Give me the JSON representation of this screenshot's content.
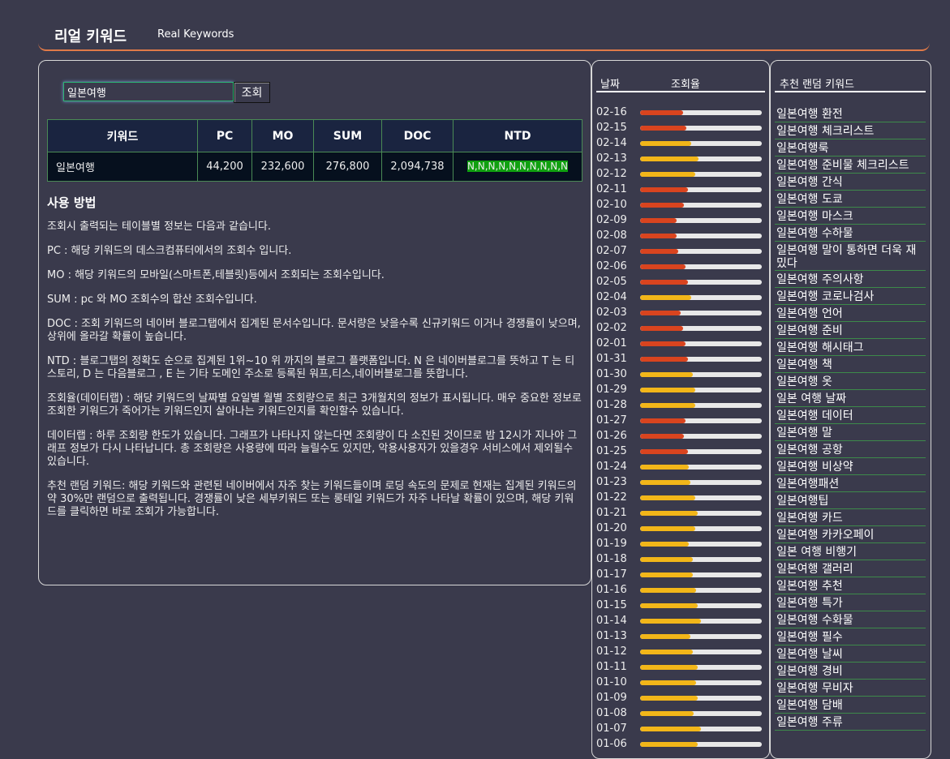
{
  "header": {
    "title": "리얼 키워드",
    "subtitle": "Real Keywords"
  },
  "search": {
    "value": "일본여행",
    "button_label": "조회"
  },
  "table": {
    "headers": [
      "키워드",
      "PC",
      "MO",
      "SUM",
      "DOC",
      "NTD"
    ],
    "row": {
      "keyword": "일본여행",
      "pc": "44,200",
      "mo": "232,600",
      "sum": "276,800",
      "doc": "2,094,738",
      "ntd": "N,N,N,N,N,N,N,N,N,N"
    }
  },
  "usage": {
    "title": "사용 방법",
    "paragraphs": [
      "조회시 출력되는 테이블별 정보는 다음과 같습니다.",
      "PC : 해당 키워드의 데스크컴퓨터에서의 조회수 입니다.",
      "MO : 해당 키워드의 모바일(스마트폰,테블릿)등에서 조회되는 조회수입니다.",
      "SUM : pc 와 MO 조회수의 합산 조회수입니다.",
      "DOC : 조회 키워드의 네이버 블로그탭에서 집계된 문서수입니다. 문서량은 낮을수록 신규키워드 이거나 경쟁률이 낮으며, 상위에 올라갈 확률이 높습니다.",
      "NTD : 블로그탭의 정확도 순으로 집계된 1위~10 위 까지의 블로그 플랫폼입니다. N 은 네이버블로그를 뜻하고 T 는 티스토리, D 는 다음블로그 , E 는 기타 도메인 주소로 등록된 워프,티스,네이버블로그를 뜻합니다.",
      "조회율(데이터랩) : 해당 키워드의 날짜별 요일별 월별 조회량으로 최근 3개월치의 정보가 표시됩니다. 매우 중요한 정보로 조회한 키워드가 죽어가는 키워드인지 살아나는 키워드인지를 확인할수 있습니다.",
      "데이터랩 : 하루 조회량 한도가 있습니다. 그래프가 나타나지 않는다면 조회량이 다 소진된 것이므로 밤 12시가 지나야 그래프 정보가 다시 나타납니다. 총 조회량은 사용량에 따라 늘릴수도 있지만, 악용사용자가 있을경우 서비스에서 제외될수 있습니다.",
      "추천 랜덤 키워드: 해당 키워드와 관련된 네이버에서 자주 찾는 키워드들이며 로딩 속도의 문제로 현재는 집계된 키워드의 약 30%만 랜덤으로 출력됩니다. 경쟁률이 낮은 세부키워드 또는 롱테일 키워드가 자주 나타날 확률이 있으며, 해당 키워드를 클릭하면 바로 조회가 가능합니다."
    ]
  },
  "rates": {
    "header_date": "날짜",
    "header_rate": "조회율",
    "colors": {
      "low": "#d9441f",
      "high": "#f2b619",
      "track": "#e8e8e8"
    },
    "items": [
      {
        "date": "02-16",
        "pct": 35,
        "level": "low"
      },
      {
        "date": "02-15",
        "pct": 38,
        "level": "low"
      },
      {
        "date": "02-14",
        "pct": 42,
        "level": "high"
      },
      {
        "date": "02-13",
        "pct": 48,
        "level": "high"
      },
      {
        "date": "02-12",
        "pct": 45,
        "level": "high"
      },
      {
        "date": "02-11",
        "pct": 39,
        "level": "low"
      },
      {
        "date": "02-10",
        "pct": 36,
        "level": "low"
      },
      {
        "date": "02-09",
        "pct": 30,
        "level": "low"
      },
      {
        "date": "02-08",
        "pct": 30,
        "level": "low"
      },
      {
        "date": "02-07",
        "pct": 31,
        "level": "low"
      },
      {
        "date": "02-06",
        "pct": 37,
        "level": "low"
      },
      {
        "date": "02-05",
        "pct": 39,
        "level": "low"
      },
      {
        "date": "02-04",
        "pct": 42,
        "level": "high"
      },
      {
        "date": "02-03",
        "pct": 33,
        "level": "low"
      },
      {
        "date": "02-02",
        "pct": 35,
        "level": "low"
      },
      {
        "date": "02-01",
        "pct": 37,
        "level": "low"
      },
      {
        "date": "01-31",
        "pct": 39,
        "level": "low"
      },
      {
        "date": "01-30",
        "pct": 43,
        "level": "high"
      },
      {
        "date": "01-29",
        "pct": 45,
        "level": "high"
      },
      {
        "date": "01-28",
        "pct": 45,
        "level": "high"
      },
      {
        "date": "01-27",
        "pct": 37,
        "level": "low"
      },
      {
        "date": "01-26",
        "pct": 36,
        "level": "low"
      },
      {
        "date": "01-25",
        "pct": 39,
        "level": "low"
      },
      {
        "date": "01-24",
        "pct": 40,
        "level": "high"
      },
      {
        "date": "01-23",
        "pct": 41,
        "level": "high"
      },
      {
        "date": "01-22",
        "pct": 45,
        "level": "high"
      },
      {
        "date": "01-21",
        "pct": 47,
        "level": "high"
      },
      {
        "date": "01-20",
        "pct": 45,
        "level": "high"
      },
      {
        "date": "01-19",
        "pct": 40,
        "level": "high"
      },
      {
        "date": "01-18",
        "pct": 43,
        "level": "high"
      },
      {
        "date": "01-17",
        "pct": 43,
        "level": "high"
      },
      {
        "date": "01-16",
        "pct": 46,
        "level": "high"
      },
      {
        "date": "01-15",
        "pct": 47,
        "level": "high"
      },
      {
        "date": "01-14",
        "pct": 50,
        "level": "high"
      },
      {
        "date": "01-13",
        "pct": 41,
        "level": "high"
      },
      {
        "date": "01-12",
        "pct": 43,
        "level": "high"
      },
      {
        "date": "01-11",
        "pct": 47,
        "level": "high"
      },
      {
        "date": "01-10",
        "pct": 46,
        "level": "high"
      },
      {
        "date": "01-09",
        "pct": 47,
        "level": "high"
      },
      {
        "date": "01-08",
        "pct": 44,
        "level": "high"
      },
      {
        "date": "01-07",
        "pct": 50,
        "level": "high"
      },
      {
        "date": "01-06",
        "pct": 47,
        "level": "high"
      }
    ]
  },
  "recommend": {
    "header": "추천 랜덤 키워드",
    "items": [
      "일본여행 환전",
      "일본여행 체크리스트",
      "일본여행룩",
      "일본여행 준비물 체크리스트",
      "일본여행 간식",
      "일본여행 도쿄",
      "일본여행 마스크",
      "일본여행 수하물",
      "일본여행 말이 통하면 더욱 재밌다",
      "일본여행 주의사항",
      "일본여행 코로나검사",
      "일본여행 언어",
      "일본여행 준비",
      "일본여행 해시태그",
      "일본여행 책",
      "일본여행 옷",
      "일본 여행 날짜",
      "일본여행 데이터",
      "일본여행 말",
      "일본여행 공항",
      "일본여행 비상약",
      "일본여행패션",
      "일본여행팁",
      "일본여행 카드",
      "일본여행 카카오페이",
      "일본 여행 비행기",
      "일본여행 갤러리",
      "일본여행 추천",
      "일본여행 특가",
      "일본여행 수화물",
      "일본여행 필수",
      "일본여행 날씨",
      "일본여행 경비",
      "일본여행 무비자",
      "일본여행 담배",
      "일본여행 주류"
    ]
  }
}
